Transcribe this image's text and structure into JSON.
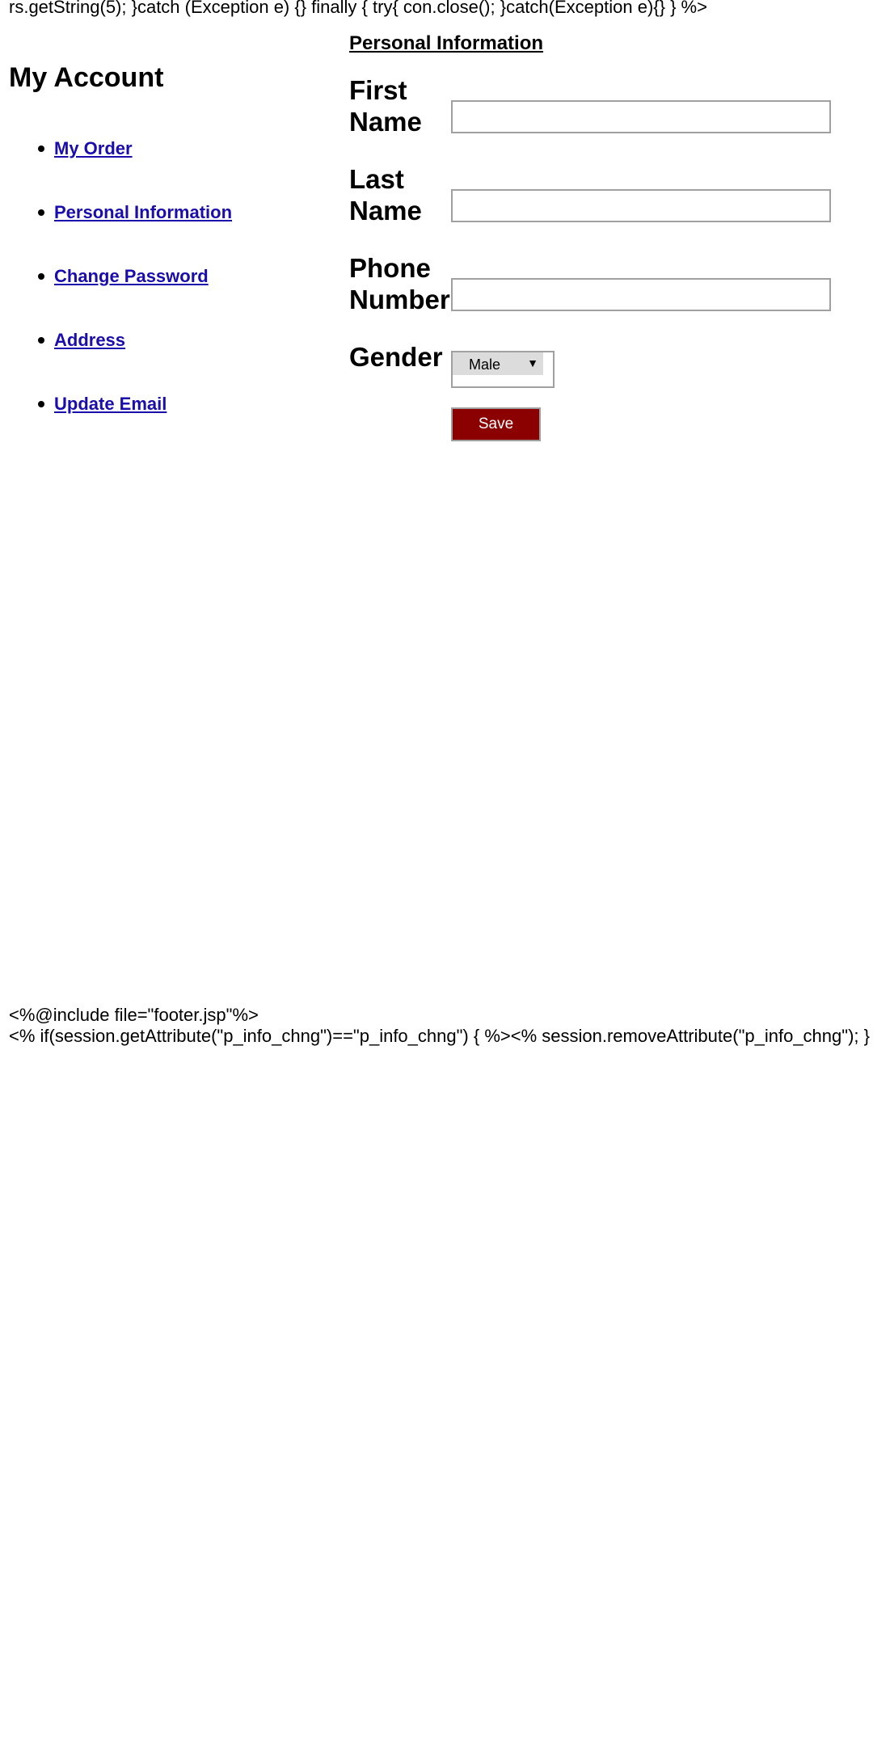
{
  "raw_code": {
    "top": "rs.getString(5); }catch (Exception e) {} finally { try{ con.close(); }catch(Exception e){} } %>",
    "footer_include": "<%@include file=\"footer.jsp\"%>",
    "footer_session": "<% if(session.getAttribute(\"p_info_chng\")==\"p_info_chng\") { %><% session.removeAttribute(\"p_info_chng\"); } %>"
  },
  "sidebar": {
    "title": "My Account",
    "items": [
      {
        "label": "My Order"
      },
      {
        "label": "Personal Information"
      },
      {
        "label": "Change Password"
      },
      {
        "label": "Address"
      },
      {
        "label": "Update Email"
      }
    ]
  },
  "form": {
    "title": "Personal Information",
    "first_name": {
      "label": "First\nName",
      "value": ""
    },
    "last_name": {
      "label": "Last\nName",
      "value": ""
    },
    "phone": {
      "label": "Phone\nNumber",
      "value": ""
    },
    "gender": {
      "label": "Gender",
      "selected": "Male"
    },
    "save_label": "Save"
  },
  "colors": {
    "link": "#1a0dab",
    "save_button": "#8b0000"
  },
  "icons": {
    "gender_dropdown": "chevron-down-icon",
    "list_bullet": "bullet-icon"
  }
}
